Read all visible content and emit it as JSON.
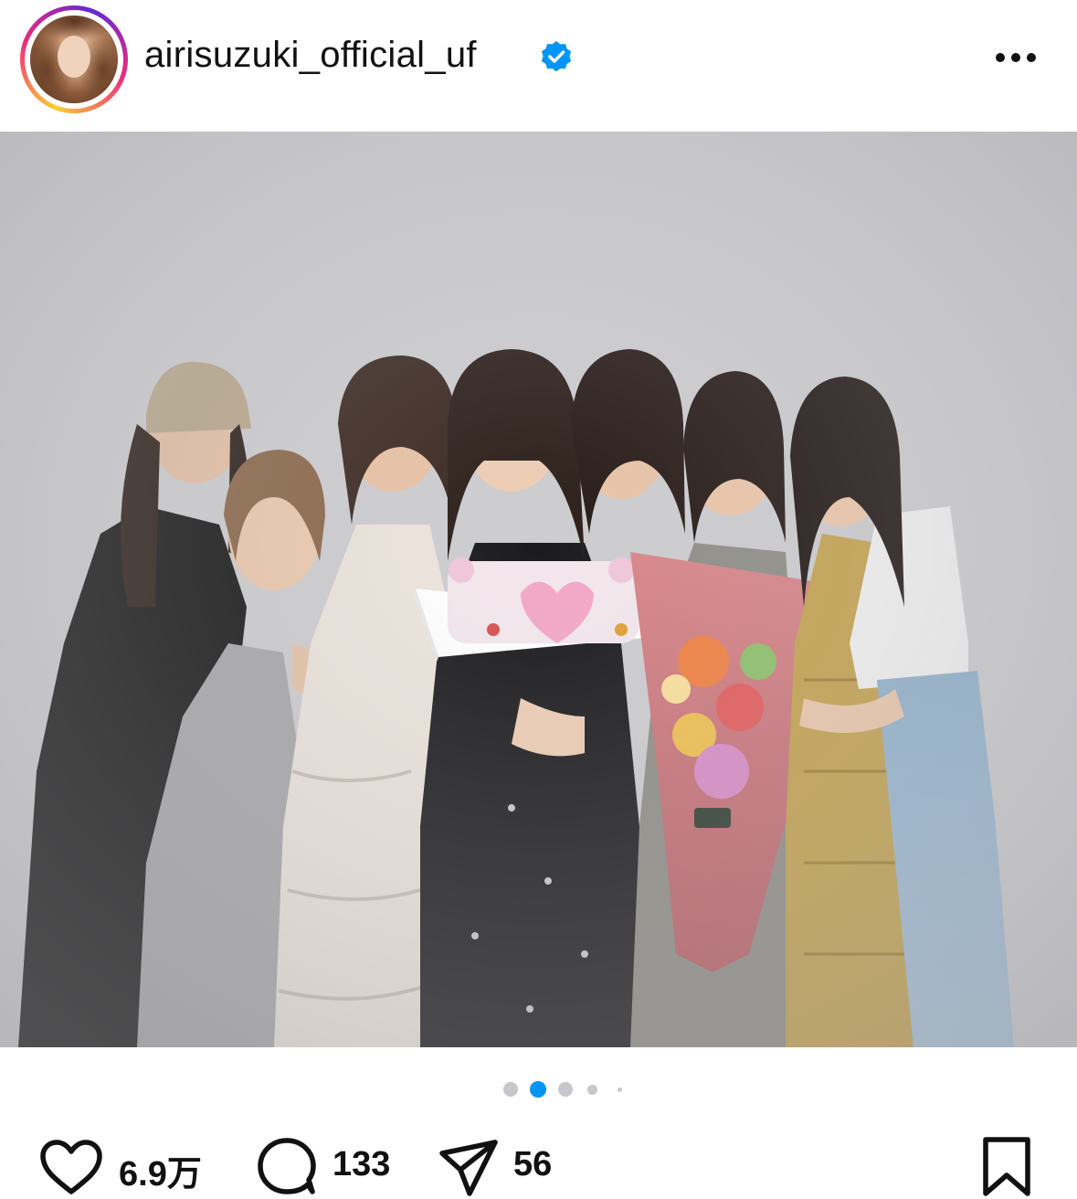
{
  "post": {
    "username": "airisuzuki_official_uf",
    "verified": true,
    "avatar": "profile-photo",
    "more_icon": "more-horizontal-icon"
  },
  "media": {
    "description": "group-photo",
    "carousel_total": 5,
    "carousel_active_index": 1
  },
  "actions": {
    "like_icon": "heart-icon",
    "like_count": "6.9万",
    "comment_icon": "comment-icon",
    "comment_count": "133",
    "share_icon": "send-icon",
    "share_count": "56",
    "save_icon": "bookmark-icon"
  },
  "colors": {
    "verified_blue": "#0095f6",
    "active_dot": "#0095f6",
    "inactive_dot": "#c7c7cc",
    "text": "#111111"
  }
}
